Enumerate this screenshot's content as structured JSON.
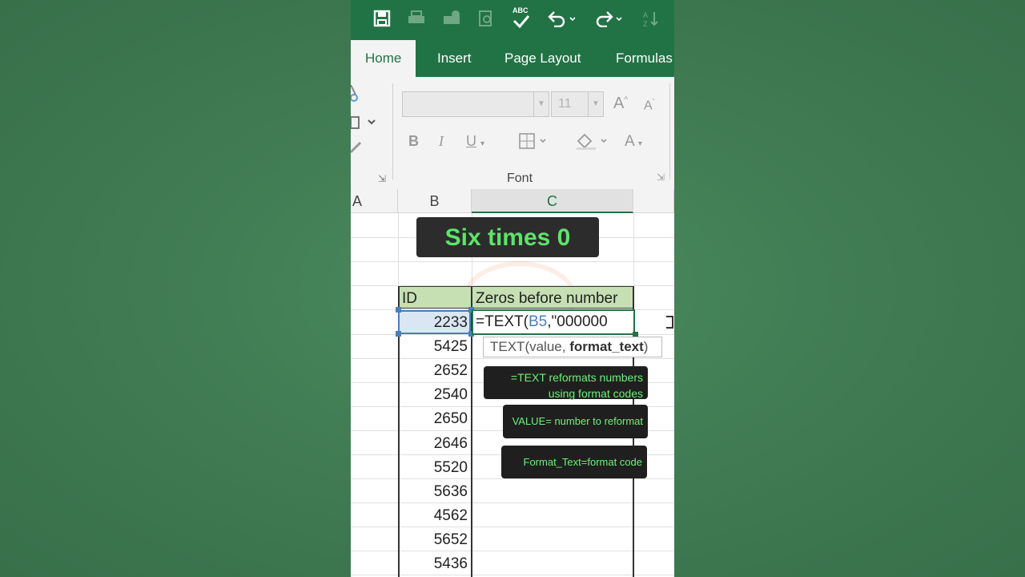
{
  "qat": {
    "icons": [
      "save-icon",
      "print-icon",
      "share-icon",
      "preview-icon",
      "spellcheck-icon",
      "undo-icon",
      "redo-icon",
      "sort-icon"
    ],
    "spellcheck_label": "ABC"
  },
  "tabs": [
    "Home",
    "Insert",
    "Page Layout",
    "Formulas"
  ],
  "ribbon": {
    "font_name": "",
    "font_size": "11",
    "font_group_label": "Font",
    "bold": "B",
    "italic": "I",
    "underline": "U",
    "font_color": "A",
    "grow_font": "A",
    "shrink_font": "A"
  },
  "columns": [
    "A",
    "B",
    "C"
  ],
  "overlay": {
    "title": "Six times 0"
  },
  "table": {
    "header_id": "ID",
    "header_c": "Zeros before number",
    "ids": [
      "2233",
      "5425",
      "2652",
      "2540",
      "2650",
      "2646",
      "5520",
      "5636",
      "4562",
      "5652",
      "5436"
    ]
  },
  "formula": {
    "prefix": "=TEXT(",
    "ref": "B5",
    "suffix": ",\"000000"
  },
  "tooltip": {
    "func": "TEXT(value, ",
    "arg": "format_text",
    "close": ")"
  },
  "notes": [
    {
      "line1": "=TEXT reformats numbers",
      "line2": "using format codes"
    },
    {
      "line1": "VALUE= number to reformat"
    },
    {
      "line1": "Format_Text=format code"
    }
  ],
  "colors": {
    "excel_green": "#217346",
    "header_fill": "#c6e0b4",
    "note_text": "#6ef07a",
    "title_text": "#5ee36a"
  }
}
